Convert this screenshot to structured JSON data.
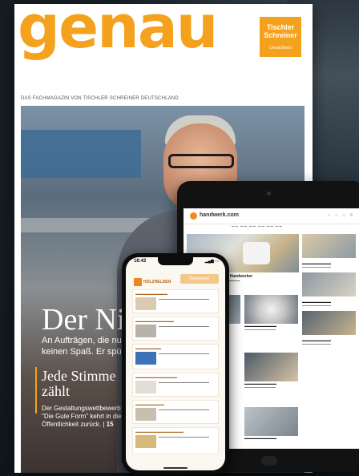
{
  "magazine": {
    "title": "genau",
    "logo_line1": "Tischler",
    "logo_line2": "Schreiner",
    "logo_line3": "Deutschland",
    "tagline": "DAS FACHMAGAZIN VON TISCHLER SCHREINER DEUTSCHLAND",
    "headline": "Der Nisc",
    "subline": "An Aufträgen, die nur über keinen Spaß. Er spürt lieb",
    "side_title": "Jede Stimme zählt",
    "side_text": "Der Gestaltungswettbewerb \"Die Gute Form\" kehrt in die Öffentlichkeit zurück.",
    "side_page": "15"
  },
  "tablet": {
    "site": "handwerk.com",
    "hero_title": "kosten: Sofortipps für Handwerker"
  },
  "phone": {
    "time": "16:42",
    "brand": "HOLZHELDEN",
    "cta": "Newsletter"
  },
  "colors": {
    "brand_orange": "#f4a21d",
    "background": "#1a2229"
  }
}
